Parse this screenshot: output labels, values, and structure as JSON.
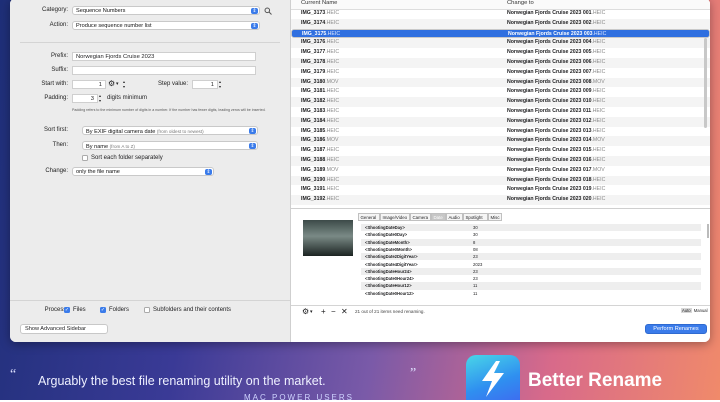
{
  "sidebar": {
    "category_label": "Category:",
    "category_value": "Sequence Numbers",
    "action_label": "Action:",
    "action_value": "Produce sequence number list",
    "prefix_label": "Prefix:",
    "prefix_value": "Norwegian Fjords Cruise 2023",
    "suffix_label": "Suffix:",
    "suffix_value": "",
    "start_label": "Start with:",
    "start_value": "1",
    "step_label": "Step value:",
    "step_value": "1",
    "padding_label": "Padding:",
    "padding_value": "3",
    "padding_unit": "digits minimum",
    "padding_help": "Padding refers to the minimum number of digits in a number. If the number has fewer digits, leading zeros will be inserted.",
    "sort_first_label": "Sort first:",
    "sort_first_value": "By EXIF digital camera date",
    "sort_first_hint": "(from oldest to newest)",
    "then_label": "Then:",
    "then_value": "By name",
    "then_hint": "(from A to Z)",
    "sort_folder_label": "Sort each folder separately",
    "change_label": "Change:",
    "change_value": "only the file name",
    "process_label": "Process:",
    "process_files": "Files",
    "process_folders": "Folders",
    "process_subfolders": "Subfolders and their contents",
    "show_sidebar_btn": "Show Advanced Sidebar"
  },
  "table": {
    "col_current": "Current Name",
    "col_change": "Change to",
    "rows": [
      {
        "name": "IMG_3173",
        "ext": ".HEIC",
        "new": "Norwegian Fjords Cruise 2023 001",
        "new_ext": ".HEIC"
      },
      {
        "name": "IMG_3174",
        "ext": ".HEIC",
        "new": "Norwegian Fjords Cruise 2023 002",
        "new_ext": ".HEIC"
      },
      {
        "name": "IMG_3175",
        "ext": ".HEIC",
        "new": "Norwegian Fjords Cruise 2023 003",
        "new_ext": ".HEIC"
      },
      {
        "name": "IMG_3176",
        "ext": ".HEIC",
        "new": "Norwegian Fjords Cruise 2023 004",
        "new_ext": ".HEIC"
      },
      {
        "name": "IMG_3177",
        "ext": ".HEIC",
        "new": "Norwegian Fjords Cruise 2023 005",
        "new_ext": ".HEIC"
      },
      {
        "name": "IMG_3178",
        "ext": ".HEIC",
        "new": "Norwegian Fjords Cruise 2023 006",
        "new_ext": ".HEIC"
      },
      {
        "name": "IMG_3179",
        "ext": ".HEIC",
        "new": "Norwegian Fjords Cruise 2023 007",
        "new_ext": ".HEIC"
      },
      {
        "name": "IMG_3180",
        "ext": ".MOV",
        "new": "Norwegian Fjords Cruise 2023 008",
        "new_ext": ".MOV"
      },
      {
        "name": "IMG_3181",
        "ext": ".HEIC",
        "new": "Norwegian Fjords Cruise 2023 009",
        "new_ext": ".HEIC"
      },
      {
        "name": "IMG_3182",
        "ext": ".HEIC",
        "new": "Norwegian Fjords Cruise 2023 010",
        "new_ext": ".HEIC"
      },
      {
        "name": "IMG_3183",
        "ext": ".HEIC",
        "new": "Norwegian Fjords Cruise 2023 011",
        "new_ext": ".HEIC"
      },
      {
        "name": "IMG_3184",
        "ext": ".HEIC",
        "new": "Norwegian Fjords Cruise 2023 012",
        "new_ext": ".HEIC"
      },
      {
        "name": "IMG_3185",
        "ext": ".HEIC",
        "new": "Norwegian Fjords Cruise 2023 013",
        "new_ext": ".HEIC"
      },
      {
        "name": "IMG_3186",
        "ext": ".MOV",
        "new": "Norwegian Fjords Cruise 2023 014",
        "new_ext": ".MOV"
      },
      {
        "name": "IMG_3187",
        "ext": ".HEIC",
        "new": "Norwegian Fjords Cruise 2023 015",
        "new_ext": ".HEIC"
      },
      {
        "name": "IMG_3188",
        "ext": ".HEIC",
        "new": "Norwegian Fjords Cruise 2023 016",
        "new_ext": ".HEIC"
      },
      {
        "name": "IMG_3189",
        "ext": ".MOV",
        "new": "Norwegian Fjords Cruise 2023 017",
        "new_ext": ".MOV"
      },
      {
        "name": "IMG_3190",
        "ext": ".HEIC",
        "new": "Norwegian Fjords Cruise 2023 018",
        "new_ext": ".HEIC"
      },
      {
        "name": "IMG_3191",
        "ext": ".HEIC",
        "new": "Norwegian Fjords Cruise 2023 019",
        "new_ext": ".HEIC"
      },
      {
        "name": "IMG_3192",
        "ext": ".HEIC",
        "new": "Norwegian Fjords Cruise 2023 020",
        "new_ext": ".HEIC"
      }
    ],
    "selected_index": 2
  },
  "metadata": {
    "tabs": [
      "General",
      "Image/Video",
      "Camera",
      "Date",
      "Audio",
      "Spotlight",
      "Misc"
    ],
    "active_tab": "Date",
    "rows": [
      {
        "k": "<ShootingDateDay>",
        "v": "30"
      },
      {
        "k": "<ShootingDate0Day>",
        "v": "30"
      },
      {
        "k": "<ShootingDateMonth>",
        "v": "8"
      },
      {
        "k": "<ShootingDate0Month>",
        "v": "08"
      },
      {
        "k": "<ShootingDate2DigitYear>",
        "v": "23"
      },
      {
        "k": "<ShootingDate4DigitYear>",
        "v": "2023"
      },
      {
        "k": "<ShootingDateHour24>",
        "v": "23"
      },
      {
        "k": "<ShootingDate0Hour24>",
        "v": "23"
      },
      {
        "k": "<ShootingDateHour12>",
        "v": "11"
      },
      {
        "k": "<ShootingDate0Hour12>",
        "v": "11"
      }
    ]
  },
  "bottom_bar": {
    "status": "21 out of 21 items need renaming.",
    "auto": "Auto",
    "manual": "Manual",
    "perform_btn": "Perform Renames"
  },
  "promo": {
    "quote_open": "“",
    "quote": "Arguably the best file renaming utility on  the market.",
    "quote_close": "”",
    "source": "MAC POWER USERS",
    "brand": "Better Rename"
  },
  "colors": {
    "accent": "#3a7bea",
    "selected_row": "#2f6fe0"
  }
}
